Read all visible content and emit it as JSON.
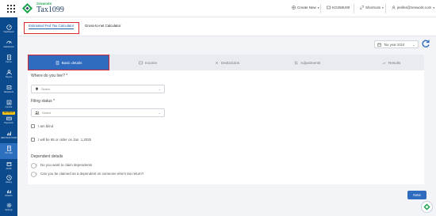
{
  "app": {
    "brand_top": "ZENWORK",
    "brand_name": "Tax1099"
  },
  "topbar": {
    "create_new": "Create New",
    "account_id": "KO258U90",
    "shortcuts": "Shortcuts",
    "user_email": "jenifer@zenwork.com"
  },
  "sidebar": {
    "badge": "ZENTRUST",
    "items": [
      {
        "label": "Dashboard",
        "icon": "dashboard-icon"
      },
      {
        "label": "Dashboard",
        "icon": "gauge-icon"
      },
      {
        "label": "Forms",
        "icon": "forms-icon"
      },
      {
        "label": "Payers",
        "icon": "payers-icon"
      },
      {
        "label": "Recipients",
        "icon": "recipients-icon"
      },
      {
        "label": "Imports",
        "icon": "imports-icon"
      },
      {
        "label": "Payments",
        "icon": "payments-icon"
      },
      {
        "label": "ZENTRUSTORM",
        "icon": "bar-chart-icon"
      },
      {
        "label": "Tax Calc",
        "icon": "calculator-icon"
      },
      {
        "label": "AFRS",
        "icon": "afrs-icon"
      },
      {
        "label": "History",
        "icon": "history-icon"
      },
      {
        "label": "Reports",
        "icon": "reports-icon"
      },
      {
        "label": "Settings",
        "icon": "settings-icon"
      }
    ]
  },
  "subtabs": {
    "estimated": "Estimated Fed Tax Calculator",
    "gross_to_net": "Gross-to-net Calculator"
  },
  "tax_year": "Tax year 2024",
  "steps": [
    {
      "label": "Basic details",
      "icon": "document-icon"
    },
    {
      "label": "Income",
      "icon": "income-icon"
    },
    {
      "label": "Deductions",
      "icon": "deductions-icon"
    },
    {
      "label": "Adjustments",
      "icon": "adjustments-icon"
    },
    {
      "label": "Results",
      "icon": "results-icon"
    }
  ],
  "form": {
    "live_label": "Where do you live? *",
    "live_placeholder": "Select",
    "filing_label": "Filing status *",
    "filing_placeholder": "Select",
    "blind_label": "I am blind",
    "age_label": "I will be 65 or older on Jan. 1,2025",
    "dependent_header": "Dependent details",
    "claim_dependents": "Do you want to claim dependents",
    "claimed_as_dependent": "Can you be claimed as a dependent on someone else's tax return?"
  },
  "next_label": "Next",
  "colors": {
    "sidebar": "#0b4a8c",
    "primary": "#2f6cc0",
    "highlight": "#d6262c",
    "brand_green": "#17a34a"
  }
}
